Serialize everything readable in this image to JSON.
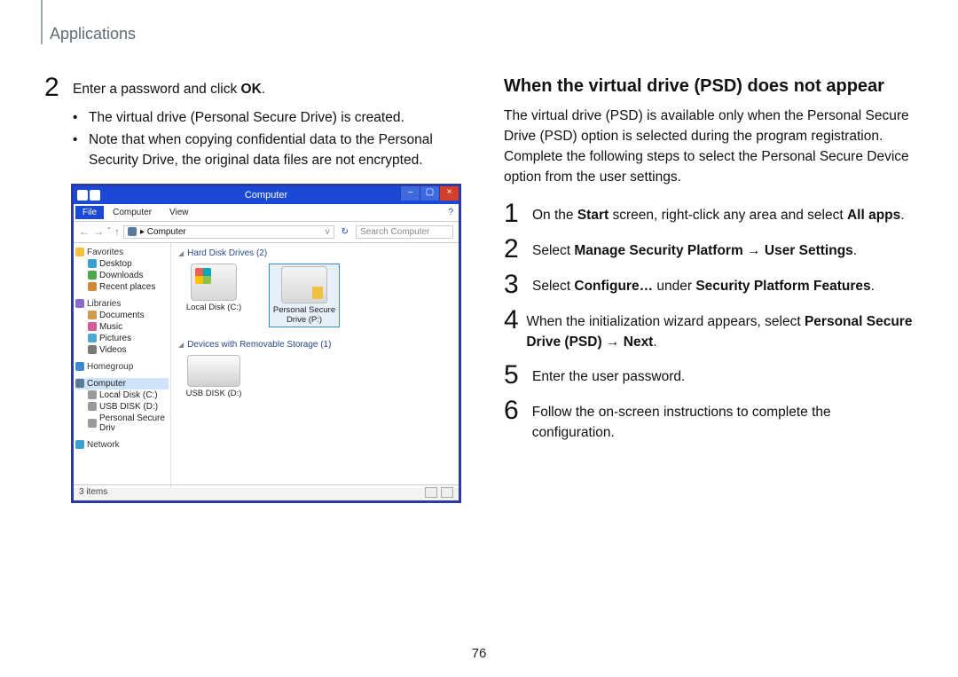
{
  "header": {
    "title": "Applications"
  },
  "left": {
    "step2": {
      "text_before": "Enter a password and click ",
      "bold": "OK",
      "text_after": "."
    },
    "bullets": [
      "The virtual drive (Personal Secure Drive) is created.",
      "Note that when copying confidential data to the Personal Security Drive, the original data files are not encrypted."
    ]
  },
  "screenshot": {
    "title": "Computer",
    "menu": {
      "file": "File",
      "computer": "Computer",
      "view": "View"
    },
    "nav": {
      "back": "←",
      "fwd": "→",
      "up": "↑",
      "breadcrumb": "▸ Computer",
      "refresh": "↻",
      "search_placeholder": "Search Computer"
    },
    "tree": {
      "favorites": {
        "head": "Favorites",
        "items": [
          "Desktop",
          "Downloads",
          "Recent places"
        ]
      },
      "libraries": {
        "head": "Libraries",
        "items": [
          "Documents",
          "Music",
          "Pictures",
          "Videos"
        ]
      },
      "homegroup": {
        "head": "Homegroup"
      },
      "computer": {
        "head": "Computer",
        "items": [
          "Local Disk (C:)",
          "USB DISK (D:)",
          "Personal Secure Driv"
        ]
      },
      "network": {
        "head": "Network"
      }
    },
    "main": {
      "cat1": "Hard Disk Drives (2)",
      "drive1": "Local Disk (C:)",
      "drive2": "Personal Secure Drive (P:)",
      "cat2": "Devices with Removable Storage (1)",
      "drive3": "USB DISK (D:)"
    },
    "status": {
      "left": "3 items"
    }
  },
  "right": {
    "heading": "When the virtual drive (PSD) does not appear",
    "para": "The virtual drive (PSD) is available only when the Personal Secure Drive (PSD) option is selected during the program registration. Complete the following steps to select the Personal Secure Device option from the user settings.",
    "steps": {
      "s1": {
        "a": "On the ",
        "b": "Start",
        "c": " screen, right-click any area and select ",
        "d": "All apps",
        "e": "."
      },
      "s2": {
        "a": "Select ",
        "b": "Manage Security Platform",
        "c": " → ",
        "d": "User Settings",
        "e": "."
      },
      "s3": {
        "a": "Select ",
        "b": "Configure…",
        "c": " under ",
        "d": "Security Platform Features",
        "e": "."
      },
      "s4": {
        "a": "When the initialization wizard appears, select ",
        "b": "Personal Secure Drive (PSD)",
        "c": " → ",
        "d": "Next",
        "e": "."
      },
      "s5": {
        "a": "Enter the user password."
      },
      "s6": {
        "a": "Follow the on-screen instructions to complete the configuration."
      }
    }
  },
  "page_number": "76",
  "numbers": {
    "n1": "1",
    "n2": "2",
    "n3": "3",
    "n4": "4",
    "n5": "5",
    "n6": "6"
  },
  "glyphs": {
    "vchk": "v",
    "caron": "ˇ",
    "dot": "•"
  }
}
